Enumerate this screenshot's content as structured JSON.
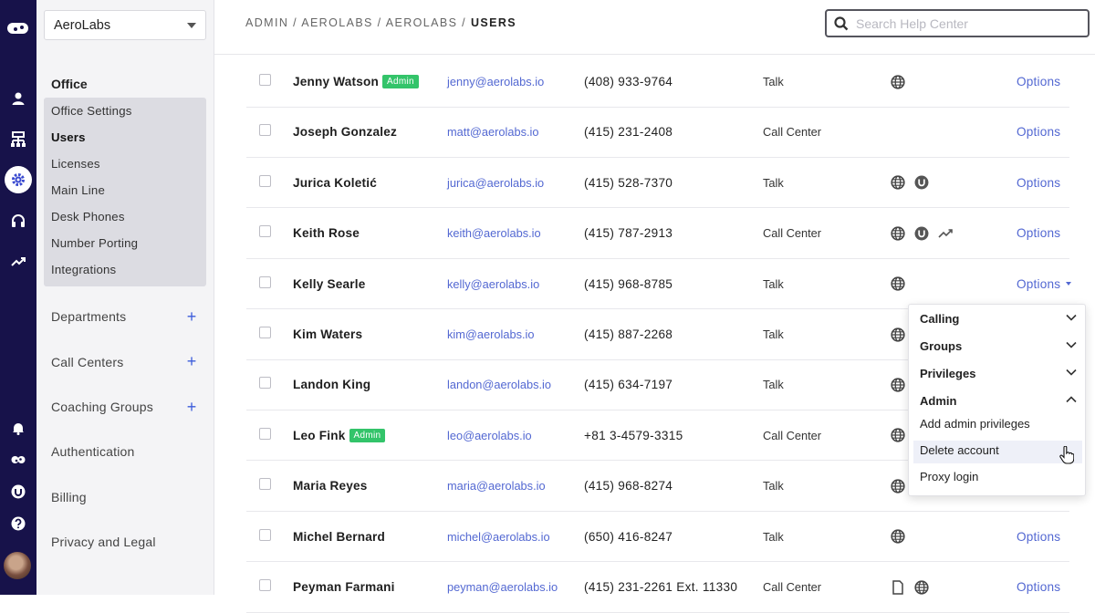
{
  "rail": {
    "icons": [
      "dialpad-logo-icon",
      "person-icon",
      "org-chart-icon",
      "gear-icon",
      "headset-icon",
      "trend-icon",
      "bell-icon",
      "dialpad-small-icon",
      "ucaas-icon",
      "help-icon",
      "avatar"
    ]
  },
  "sidebar": {
    "org_select": "AeroLabs",
    "office_heading": "Office",
    "office_items": [
      {
        "label": "Office Settings"
      },
      {
        "label": "Users",
        "active": true
      },
      {
        "label": "Licenses"
      },
      {
        "label": "Main Line"
      },
      {
        "label": "Desk Phones"
      },
      {
        "label": "Number Porting"
      },
      {
        "label": "Integrations"
      }
    ],
    "sections": [
      {
        "label": "Departments",
        "plus": true
      },
      {
        "label": "Call Centers",
        "plus": true
      },
      {
        "label": "Coaching Groups",
        "plus": true
      },
      {
        "label": "Authentication",
        "plus": false
      },
      {
        "label": "Billing",
        "plus": false
      },
      {
        "label": "Privacy and Legal",
        "plus": false
      }
    ]
  },
  "topbar": {
    "breadcrumb_prefix": "ADMIN / AEROLABS / AEROLABS / ",
    "breadcrumb_current": "USERS",
    "search_placeholder": "Search Help Center"
  },
  "users": [
    {
      "name": "Jenny Watson",
      "admin": true,
      "email": "jenny@aerolabs.io",
      "phone": "(408) 933-9764",
      "type": "Talk",
      "icons": [
        "globe-icon"
      ],
      "options": "Options"
    },
    {
      "name": "Joseph Gonzalez",
      "admin": false,
      "email": "matt@aerolabs.io",
      "phone": "(415) 231-2408",
      "type": "Call Center",
      "icons": [],
      "options": "Options"
    },
    {
      "name": "Jurica Koletić",
      "admin": false,
      "email": "jurica@aerolabs.io",
      "phone": "(415) 528-7370",
      "type": "Talk",
      "icons": [
        "globe-icon",
        "uc-icon"
      ],
      "options": "Options"
    },
    {
      "name": "Keith Rose",
      "admin": false,
      "email": "keith@aerolabs.io",
      "phone": "(415) 787-2913",
      "type": "Call Center",
      "icons": [
        "globe-icon",
        "uc-icon",
        "trend-icon"
      ],
      "options": "Options"
    },
    {
      "name": "Kelly Searle",
      "admin": false,
      "email": "kelly@aerolabs.io",
      "phone": "(415) 968-8785",
      "type": "Talk",
      "icons": [
        "globe-icon"
      ],
      "options": "Options",
      "open": true
    },
    {
      "name": "Kim Waters",
      "admin": false,
      "email": "kim@aerolabs.io",
      "phone": "(415) 887-2268",
      "type": "Talk",
      "icons": [
        "globe-icon"
      ],
      "options": ""
    },
    {
      "name": "Landon King",
      "admin": false,
      "email": "landon@aerolabs.io",
      "phone": "(415) 634-7197",
      "type": "Talk",
      "icons": [
        "globe-icon"
      ],
      "options": ""
    },
    {
      "name": "Leo Fink",
      "admin": true,
      "email": "leo@aerolabs.io",
      "phone": "+81 3-4579-3315",
      "type": "Call Center",
      "icons": [
        "globe-icon"
      ],
      "options": ""
    },
    {
      "name": "Maria Reyes",
      "admin": false,
      "email": "maria@aerolabs.io",
      "phone": "(415) 968-8274",
      "type": "Talk",
      "icons": [
        "globe-icon"
      ],
      "options": ""
    },
    {
      "name": "Michel Bernard",
      "admin": false,
      "email": "michel@aerolabs.io",
      "phone": "(650) 416-8247",
      "type": "Talk",
      "icons": [
        "globe-icon"
      ],
      "options": "Options"
    },
    {
      "name": "Peyman Farmani",
      "admin": false,
      "email": "peyman@aerolabs.io",
      "phone": "(415) 231-2261 Ext. 11330",
      "type": "Call Center",
      "icons": [
        "document-icon",
        "globe-icon"
      ],
      "options": "Options"
    }
  ],
  "admin_badge": "Admin",
  "options_menu": {
    "sections": [
      {
        "label": "Calling",
        "expanded": false
      },
      {
        "label": "Groups",
        "expanded": false
      },
      {
        "label": "Privileges",
        "expanded": false
      },
      {
        "label": "Admin",
        "expanded": true
      }
    ],
    "admin_items": [
      "Add admin privileges",
      "Delete account",
      "Proxy login"
    ],
    "hovered_item": "Delete account"
  },
  "colors": {
    "rail": "#17124a",
    "link": "#5368d2",
    "admin_badge": "#33c46a",
    "accent_plus": "#3b5bdb"
  }
}
